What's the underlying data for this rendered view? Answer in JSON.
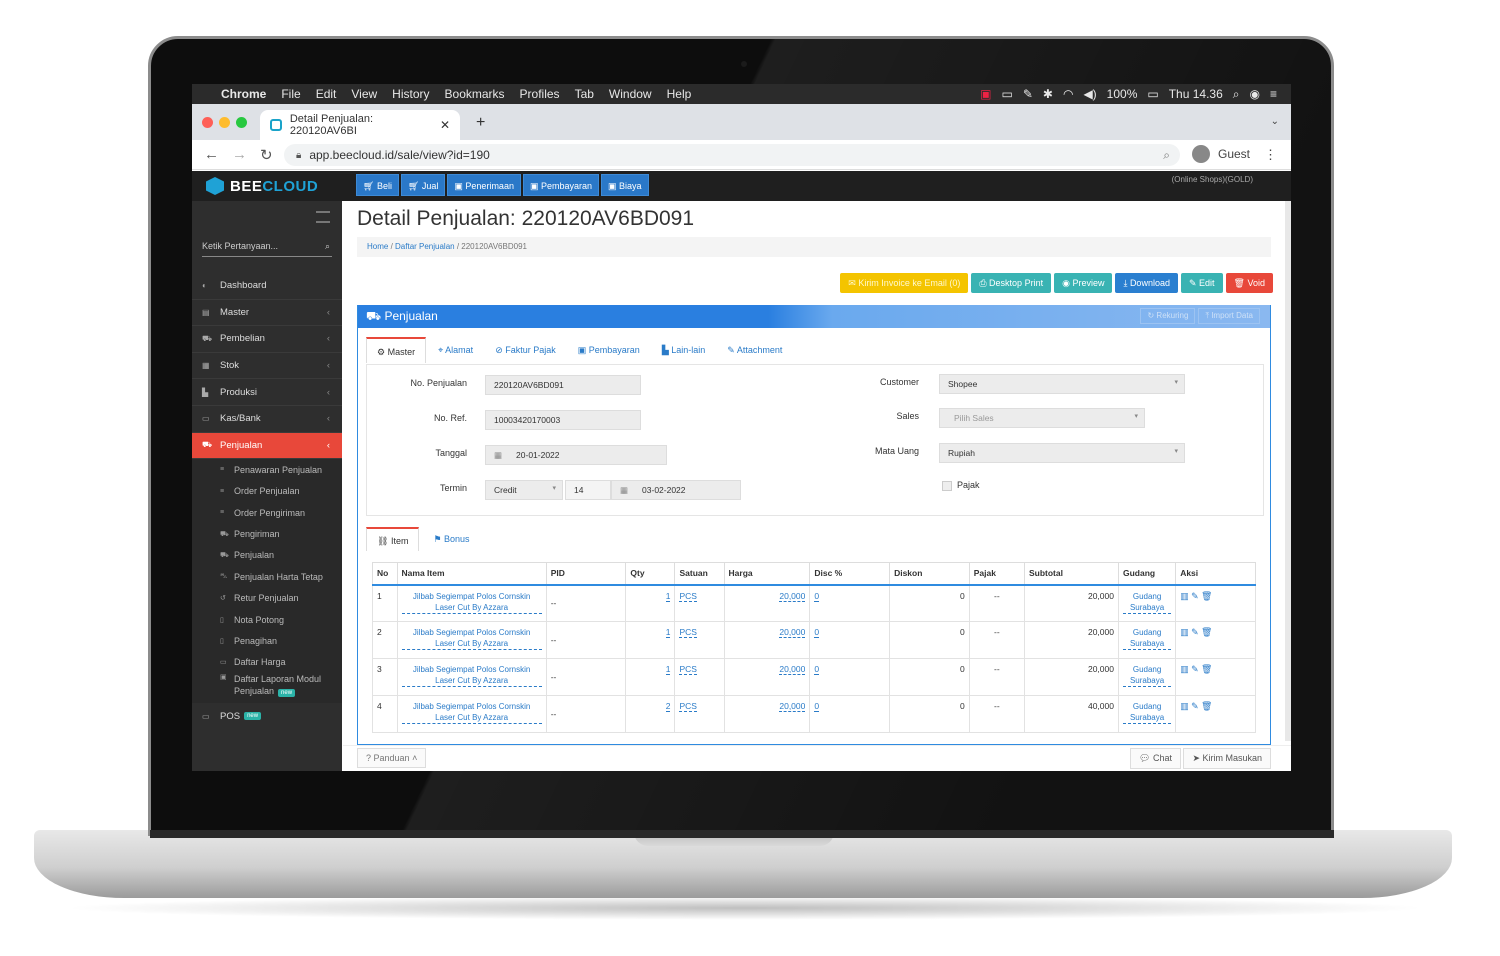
{
  "macos": {
    "menus": [
      "Chrome",
      "File",
      "Edit",
      "View",
      "History",
      "Bookmarks",
      "Profiles",
      "Tab",
      "Window",
      "Help"
    ],
    "battery": "100%",
    "clock": "Thu 14.36"
  },
  "browser": {
    "tab_title": "Detail Penjualan: 220120AV6BI",
    "url": "app.beecloud.id/sale/view?id=190",
    "profile": "Guest"
  },
  "app": {
    "logo_a": "BEE",
    "logo_b": "CLOUD",
    "topnav": [
      "Beli",
      "Jual",
      "Penerimaan",
      "Pembayaran",
      "Biaya"
    ],
    "plan": "(Online Shops)(GOLD)"
  },
  "sidebar": {
    "search_placeholder": "Ketik Pertanyaan...",
    "items": [
      {
        "label": "Dashboard",
        "icon": "dashboard-icon"
      },
      {
        "label": "Master",
        "icon": "list-icon"
      },
      {
        "label": "Pembelian",
        "icon": "cart-icon"
      },
      {
        "label": "Stok",
        "icon": "box-icon"
      },
      {
        "label": "Produksi",
        "icon": "chart-icon"
      },
      {
        "label": "Kas/Bank",
        "icon": "money-icon"
      },
      {
        "label": "Penjualan",
        "icon": "cart-icon"
      }
    ],
    "sub_items": [
      "Penawaran Penjualan",
      "Order Penjualan",
      "Order Pengiriman",
      "Pengiriman",
      "Penjualan",
      "Penjualan Harta Tetap",
      "Retur Penjualan",
      "Nota Potong",
      "Penagihan",
      "Daftar Harga",
      "Daftar Laporan Modul"
    ],
    "sub_last_line2": "Penjualan",
    "new_badge": "new",
    "pos": "POS"
  },
  "page": {
    "title": "Detail Penjualan: 220120AV6BD091",
    "breadcrumb": [
      "Home",
      "Daftar Penjualan",
      "220120AV6BD091"
    ],
    "actions": [
      {
        "label": "Kirim Invoice ke Email (0)",
        "color": "#f4c400"
      },
      {
        "label": "Desktop Print",
        "color": "#39b3b3"
      },
      {
        "label": "Preview",
        "color": "#39b3b3"
      },
      {
        "label": "Download",
        "color": "#2a7fd0"
      },
      {
        "label": "Edit",
        "color": "#39b3b3"
      },
      {
        "label": "Void",
        "color": "#e8483a"
      }
    ],
    "panel_title": "Penjualan",
    "panel_buttons": [
      "Rekuring",
      "Import Data"
    ],
    "tabs": [
      "Master",
      "Alamat",
      "Faktur Pajak",
      "Pembayaran",
      "Lain-lain",
      "Attachment"
    ],
    "form": {
      "no_penjualan_label": "No. Penjualan",
      "no_penjualan": "220120AV6BD091",
      "no_ref_label": "No. Ref.",
      "no_ref": "10003420170003",
      "tanggal_label": "Tanggal",
      "tanggal": "20-01-2022",
      "termin_label": "Termin",
      "termin_type": "Credit",
      "termin_days": "14",
      "termin_date": "03-02-2022",
      "customer_label": "Customer",
      "customer": "Shopee",
      "sales_label": "Sales",
      "sales_placeholder": "Pilih Sales",
      "mata_uang_label": "Mata Uang",
      "mata_uang": "Rupiah",
      "pajak_label": "Pajak"
    },
    "item_tabs": [
      "Item",
      "Bonus"
    ],
    "columns": [
      "No",
      "Nama Item",
      "PID",
      "Qty",
      "Satuan",
      "Harga",
      "Disc %",
      "Diskon",
      "Pajak",
      "Subtotal",
      "Gudang",
      "Aksi"
    ],
    "rows": [
      {
        "no": "1",
        "item1": "Jilbab Segiempat Polos Cornskin",
        "item2": "Laser Cut By Azzara",
        "pid": "--",
        "qty": "1",
        "satuan": "PCS",
        "harga": "20,000",
        "disc": "0",
        "diskon": "0",
        "pajak": "--",
        "subtotal": "20,000",
        "gudang1": "Gudang",
        "gudang2": "Surabaya"
      },
      {
        "no": "2",
        "item1": "Jilbab Segiempat Polos Cornskin",
        "item2": "Laser Cut By Azzara",
        "pid": "--",
        "qty": "1",
        "satuan": "PCS",
        "harga": "20,000",
        "disc": "0",
        "diskon": "0",
        "pajak": "--",
        "subtotal": "20,000",
        "gudang1": "Gudang",
        "gudang2": "Surabaya"
      },
      {
        "no": "3",
        "item1": "Jilbab Segiempat Polos Cornskin",
        "item2": "Laser Cut By Azzara",
        "pid": "--",
        "qty": "1",
        "satuan": "PCS",
        "harga": "20,000",
        "disc": "0",
        "diskon": "0",
        "pajak": "--",
        "subtotal": "20,000",
        "gudang1": "Gudang",
        "gudang2": "Surabaya"
      },
      {
        "no": "4",
        "item1": "Jilbab Segiempat Polos Cornskin",
        "item2": "Laser Cut By Azzara",
        "pid": "--",
        "qty": "2",
        "satuan": "PCS",
        "harga": "20,000",
        "disc": "0",
        "diskon": "0",
        "pajak": "--",
        "subtotal": "40,000",
        "gudang1": "Gudang",
        "gudang2": "Surabaya"
      }
    ],
    "footer": {
      "panduan": "Panduan",
      "chat": "Chat",
      "kirim": "Kirim Masukan"
    }
  }
}
